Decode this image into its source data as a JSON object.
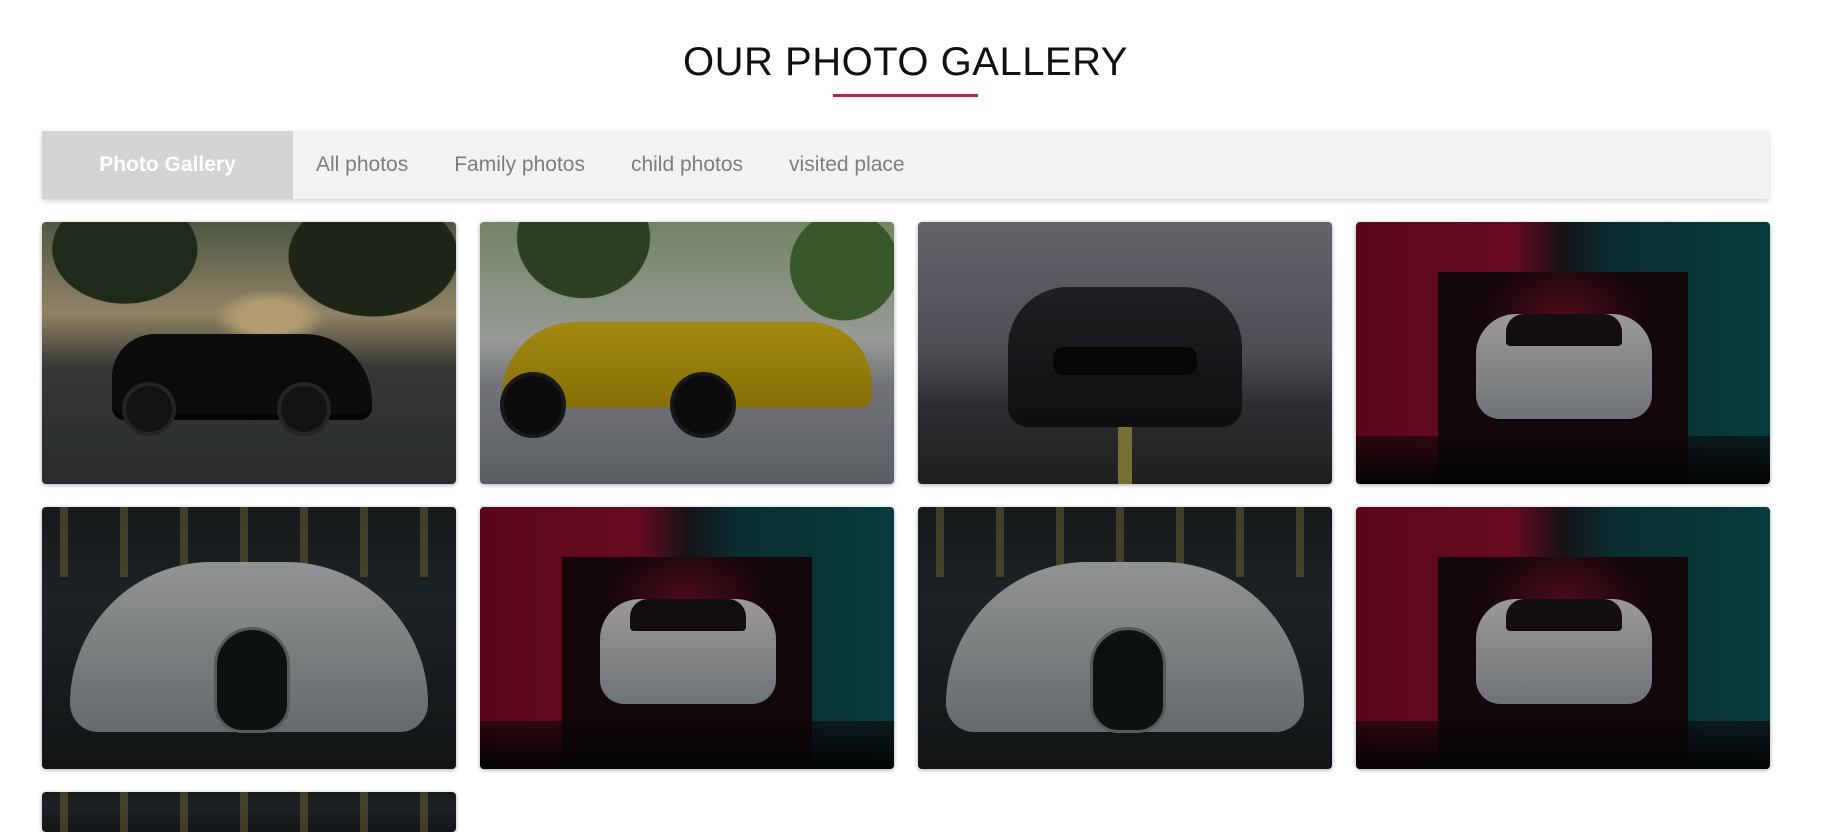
{
  "page": {
    "title": "OUR PHOTO GALLERY"
  },
  "filterbar": {
    "brand": "Photo Gallery",
    "items": [
      "All photos",
      "Family photos",
      "child photos",
      "visited place"
    ]
  },
  "gallery": {
    "photos": [
      {
        "scene": "black-sports-car-in-park"
      },
      {
        "scene": "yellow-supercar"
      },
      {
        "scene": "black-mustang-front"
      },
      {
        "scene": "mercedes-in-red-teal-garage"
      },
      {
        "scene": "silver-bugatti-front"
      },
      {
        "scene": "mercedes-in-red-teal-garage"
      },
      {
        "scene": "silver-bugatti-front"
      },
      {
        "scene": "mercedes-in-red-teal-garage"
      },
      {
        "scene": "silver-bugatti-front"
      }
    ]
  },
  "colors": {
    "accent": "#c41e4a",
    "filterbar_bg": "#f2f2f2",
    "brand_bg": "#d4d4d4",
    "filter_text": "#7d7d7d"
  }
}
